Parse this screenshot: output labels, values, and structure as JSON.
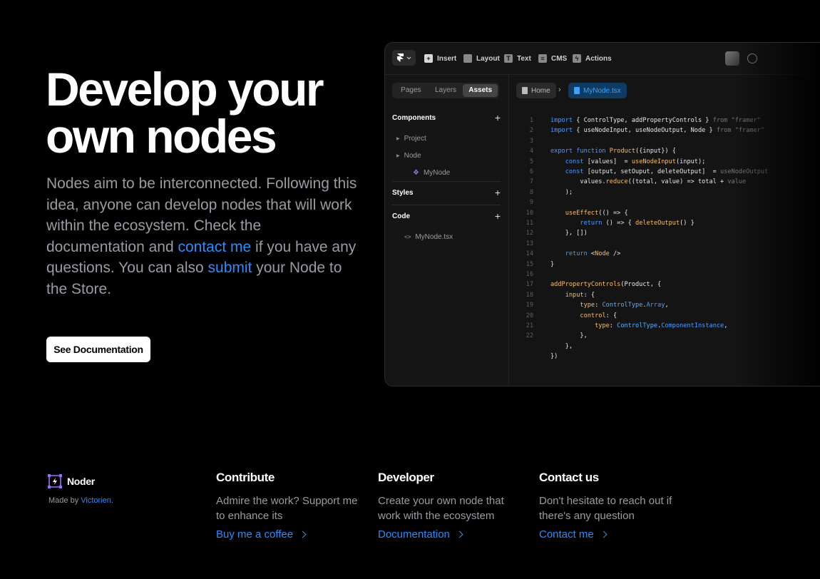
{
  "hero": {
    "title": "Develop your own nodes",
    "desc_1": "Nodes aim to be interconnected. Following this idea, anyone can develop nodes that will work within the ecosystem. Check the documentation and ",
    "link_contact": "contact me",
    "desc_2": " if you have any questions. You can also ",
    "link_submit": "submit",
    "desc_3": " your Node to the Store.",
    "button": "See Documentation"
  },
  "editor": {
    "toolbar": [
      "Insert",
      "Layout",
      "Text",
      "CMS",
      "Actions"
    ],
    "tabs": [
      "Pages",
      "Layers",
      "Assets"
    ],
    "active_tab": "Assets",
    "sections": {
      "components": "Components",
      "styles": "Styles",
      "code": "Code"
    },
    "tree": {
      "project": "Project",
      "node": "Node",
      "mynode": "MyNode",
      "file": "MyNode.tsx"
    },
    "breadcrumb": {
      "home": "Home",
      "file": "MyNode.tsx"
    },
    "code_lines": [
      "import { ControlType, addPropertyControls } from \"framer\"",
      "import { useNodeInput, useNodeOutput, Node } from \"framer\"",
      "",
      "export function Product({input}) {",
      "    const [values]  = useNodeInput(input);",
      "    const [output, setOuput, deleteOutput]  = useNodeOutput",
      "        values.reduce((total, value) => total + value",
      "    );",
      "",
      "    useEffect(() => {",
      "        return () => { deleteOutput() }",
      "    }, [])",
      "",
      "    return <Node />",
      "}",
      "",
      "addPropertyControls(Product, {",
      "    input: {",
      "        type: ControlType.Array,",
      "        control: {",
      "            type: ControlType.ComponentInstance,",
      "        },",
      "    },",
      "})"
    ]
  },
  "footer": {
    "brand": "Noder",
    "made_by": "Made by ",
    "author": "Victorien",
    "author_suffix": ".",
    "contribute": {
      "title": "Contribute",
      "text": "Admire the work? Support me to enhance its",
      "link": "Buy me a coffee"
    },
    "developer": {
      "title": "Developer",
      "text": "Create your own node that work with the ecosystem",
      "link": "Documentation"
    },
    "contact": {
      "title": "Contact us",
      "text": "Don't hesitate to reach out if there's any question",
      "link": "Contact me"
    }
  },
  "colors": {
    "accent": "#2e8cf8",
    "background": "#000000",
    "muted": "#9a9aa3",
    "purple": "#9b6cff"
  }
}
